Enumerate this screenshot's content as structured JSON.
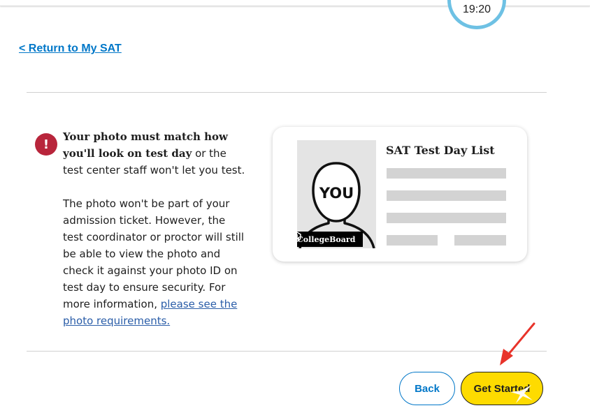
{
  "header": {
    "timer": "19:20"
  },
  "nav": {
    "return_link": "< Return to My SAT"
  },
  "notice": {
    "icon": "alert-icon",
    "bold_text": "Your photo must match how you'll look on test day",
    "rest_text": " or the test center staff won't let you test.",
    "info_text": "The photo won't be part of your admission ticket. However, the test coordinator or proctor will still be able to view the photo and check it against your photo ID on test day to ensure security. For more information, ",
    "link_text": "please see the photo requirements."
  },
  "card": {
    "title": "SAT Test Day List",
    "photo_label": "YOU",
    "brand": "CollegeBoard"
  },
  "actions": {
    "back_label": "Back",
    "start_label": "Get Started"
  },
  "colors": {
    "link": "#0077c8",
    "primary_button": "#fedb00",
    "alert": "#b8253b",
    "timer_ring": "#6ec1e4",
    "annotation_arrow": "#e8332a"
  }
}
